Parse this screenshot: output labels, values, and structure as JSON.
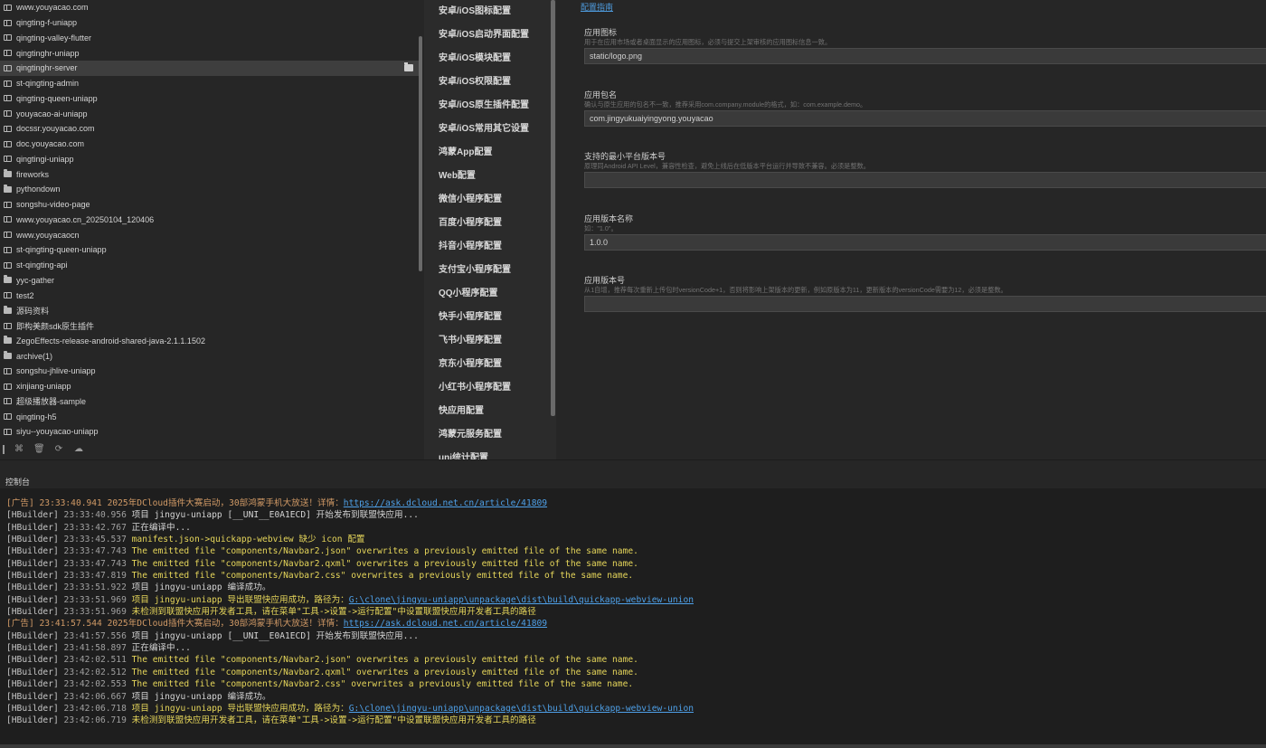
{
  "sidebar": {
    "items": [
      {
        "label": "www.youyacao.com",
        "icon": "project-icon"
      },
      {
        "label": "qingting-f-uniapp",
        "icon": "project-icon"
      },
      {
        "label": "qingting-valley-flutter",
        "icon": "project-icon"
      },
      {
        "label": "qingtinghr-uniapp",
        "icon": "project-icon"
      },
      {
        "label": "qingtinghr-server",
        "icon": "project-icon",
        "selected": true
      },
      {
        "label": "st-qingting-admin",
        "icon": "project-icon"
      },
      {
        "label": "qingting-queen-uniapp",
        "icon": "project-icon"
      },
      {
        "label": "youyacao-ai-uniapp",
        "icon": "project-icon"
      },
      {
        "label": "docssr.youyacao.com",
        "icon": "project-icon"
      },
      {
        "label": "doc.youyacao.com",
        "icon": "project-icon"
      },
      {
        "label": "qingtingi-uniapp",
        "icon": "project-icon"
      },
      {
        "label": "fireworks",
        "icon": "folder-icon"
      },
      {
        "label": "pythondown",
        "icon": "folder-icon"
      },
      {
        "label": "songshu-video-page",
        "icon": "project-icon"
      },
      {
        "label": "www.youyacao.cn_20250104_120406",
        "icon": "project-icon"
      },
      {
        "label": "www.youyacaocn",
        "icon": "project-icon"
      },
      {
        "label": "st-qingting-queen-uniapp",
        "icon": "project-icon"
      },
      {
        "label": "st-qingting-api",
        "icon": "project-icon"
      },
      {
        "label": "yyc-gather",
        "icon": "folder-icon"
      },
      {
        "label": "test2",
        "icon": "project-icon"
      },
      {
        "label": "源码资料",
        "icon": "folder-icon"
      },
      {
        "label": "即构美颜sdk原生插件",
        "icon": "project-icon"
      },
      {
        "label": "ZegoEffects-release-android-shared-java-2.1.1.1502",
        "icon": "folder-icon"
      },
      {
        "label": "archive(1)",
        "icon": "folder-icon"
      },
      {
        "label": "songshu-jhlive-uniapp",
        "icon": "project-icon"
      },
      {
        "label": "xinjiang-uniapp",
        "icon": "project-icon"
      },
      {
        "label": "超级播放器-sample",
        "icon": "project-icon"
      },
      {
        "label": "qingting-h5",
        "icon": "project-icon"
      },
      {
        "label": "siyu--youyacao-uniapp",
        "icon": "project-icon"
      }
    ],
    "toolbar_icons": [
      "divider",
      "graph-icon",
      "trash-icon",
      "refresh-icon",
      "cloud-icon"
    ]
  },
  "config_nav": {
    "items": [
      "安卓/iOS图标配置",
      "安卓/iOS启动界面配置",
      "安卓/iOS模块配置",
      "安卓/iOS权限配置",
      "安卓/iOS原生插件配置",
      "安卓/iOS常用其它设置",
      "鸿蒙App配置",
      "Web配置",
      "微信小程序配置",
      "百度小程序配置",
      "抖音小程序配置",
      "支付宝小程序配置",
      "QQ小程序配置",
      "快手小程序配置",
      "飞书小程序配置",
      "京东小程序配置",
      "小红书小程序配置",
      "快应用配置",
      "鸿蒙元服务配置",
      "uni统计配置"
    ]
  },
  "form": {
    "guide_link": "配置指南",
    "fields": [
      {
        "label": "应用图标",
        "desc": "用于在应用市场或者桌面显示的应用图标，必须与提交上架审核的应用图标信息一致。",
        "value": "static/logo.png"
      },
      {
        "label": "应用包名",
        "desc": "确认与原生应用的包名不一致，推荐采用com.company.module的格式，如：com.example.demo。",
        "value": "com.jingyukuaiyingyong.youyacao"
      },
      {
        "label": "支持的最小平台版本号",
        "desc": "原理同Android API Level，兼容性检查，避免上线后在低版本平台运行并导致不兼容。必须是整数。",
        "value": ""
      },
      {
        "label": "应用版本名称",
        "desc": "如：\"1.0\"。",
        "value": "1.0.0"
      },
      {
        "label": "应用版本号",
        "desc": "从1自增，推荐每次重新上传包时versionCode+1，否则将影响上架版本的更新，例如原版本为11，更新版本的versionCode需要为12，必须是整数。",
        "value": ""
      }
    ]
  },
  "console": {
    "tab_label": "控制台",
    "lines": [
      [
        {
          "t": "[广告] ",
          "c": "ad"
        },
        {
          "t": "23:33:40.941 ",
          "c": "ad"
        },
        {
          "t": "2025年DCloud插件大赛启动，30部鸿蒙手机大放送！详情：",
          "c": "ad"
        },
        {
          "t": "https://ask.dcloud.net.cn/article/41809",
          "c": "link"
        }
      ],
      [
        {
          "t": "[HBuilder] ",
          "c": "tag"
        },
        {
          "t": "23:33:40.956 ",
          "c": "time"
        },
        {
          "t": "项目 jingyu-uniapp [__UNI__E0A1ECD] 开始发布到联盟快应用...",
          "c": "msg"
        }
      ],
      [
        {
          "t": "[HBuilder] ",
          "c": "tag"
        },
        {
          "t": "23:33:42.767 ",
          "c": "time"
        },
        {
          "t": "正在编译中...",
          "c": "msg"
        }
      ],
      [
        {
          "t": "[HBuilder] ",
          "c": "tag"
        },
        {
          "t": "23:33:45.537 ",
          "c": "time"
        },
        {
          "t": "manifest.json->quickapp-webview 缺少 icon 配置",
          "c": "yellow"
        }
      ],
      [
        {
          "t": "[HBuilder] ",
          "c": "tag"
        },
        {
          "t": "23:33:47.743 ",
          "c": "time"
        },
        {
          "t": "The emitted file \"components/Navbar2.json\" overwrites a previously emitted file of the same name.",
          "c": "yellow"
        }
      ],
      [
        {
          "t": "[HBuilder] ",
          "c": "tag"
        },
        {
          "t": "23:33:47.743 ",
          "c": "time"
        },
        {
          "t": "The emitted file \"components/Navbar2.qxml\" overwrites a previously emitted file of the same name.",
          "c": "yellow"
        }
      ],
      [
        {
          "t": "[HBuilder] ",
          "c": "tag"
        },
        {
          "t": "23:33:47.819 ",
          "c": "time"
        },
        {
          "t": "The emitted file \"components/Navbar2.css\" overwrites a previously emitted file of the same name.",
          "c": "yellow"
        }
      ],
      [
        {
          "t": "[HBuilder] ",
          "c": "tag"
        },
        {
          "t": "23:33:51.922 ",
          "c": "time"
        },
        {
          "t": "项目 jingyu-uniapp 编译成功。",
          "c": "msg"
        }
      ],
      [
        {
          "t": "[HBuilder] ",
          "c": "tag"
        },
        {
          "t": "23:33:51.969 ",
          "c": "time"
        },
        {
          "t": "项目 jingyu-uniapp 导出联盟快应用成功，路径为：",
          "c": "yellow"
        },
        {
          "t": "G:\\clone\\jingyu-uniapp\\unpackage\\dist\\build\\quickapp-webview-union",
          "c": "link"
        }
      ],
      [
        {
          "t": "[HBuilder] ",
          "c": "tag"
        },
        {
          "t": "23:33:51.969 ",
          "c": "time"
        },
        {
          "t": "未检测到联盟快应用开发者工具，请在菜单\"工具->设置->运行配置\"中设置联盟快应用开发者工具的路径",
          "c": "yellow"
        }
      ],
      [
        {
          "t": "[广告] ",
          "c": "ad"
        },
        {
          "t": "23:41:57.544 ",
          "c": "ad"
        },
        {
          "t": "2025年DCloud插件大赛启动，30部鸿蒙手机大放送！详情：",
          "c": "ad"
        },
        {
          "t": "https://ask.dcloud.net.cn/article/41809",
          "c": "link"
        }
      ],
      [
        {
          "t": "[HBuilder] ",
          "c": "tag"
        },
        {
          "t": "23:41:57.556 ",
          "c": "time"
        },
        {
          "t": "项目 jingyu-uniapp [__UNI__E0A1ECD] 开始发布到联盟快应用...",
          "c": "msg"
        }
      ],
      [
        {
          "t": "[HBuilder] ",
          "c": "tag"
        },
        {
          "t": "23:41:58.897 ",
          "c": "time"
        },
        {
          "t": "正在编译中...",
          "c": "msg"
        }
      ],
      [
        {
          "t": "[HBuilder] ",
          "c": "tag"
        },
        {
          "t": "23:42:02.511 ",
          "c": "time"
        },
        {
          "t": "The emitted file \"components/Navbar2.json\" overwrites a previously emitted file of the same name.",
          "c": "yellow"
        }
      ],
      [
        {
          "t": "[HBuilder] ",
          "c": "tag"
        },
        {
          "t": "23:42:02.512 ",
          "c": "time"
        },
        {
          "t": "The emitted file \"components/Navbar2.qxml\" overwrites a previously emitted file of the same name.",
          "c": "yellow"
        }
      ],
      [
        {
          "t": "[HBuilder] ",
          "c": "tag"
        },
        {
          "t": "23:42:02.553 ",
          "c": "time"
        },
        {
          "t": "The emitted file \"components/Navbar2.css\" overwrites a previously emitted file of the same name.",
          "c": "yellow"
        }
      ],
      [
        {
          "t": "[HBuilder] ",
          "c": "tag"
        },
        {
          "t": "23:42:06.667 ",
          "c": "time"
        },
        {
          "t": "项目 jingyu-uniapp 编译成功。",
          "c": "msg"
        }
      ],
      [
        {
          "t": "[HBuilder] ",
          "c": "tag"
        },
        {
          "t": "23:42:06.718 ",
          "c": "time"
        },
        {
          "t": "项目 jingyu-uniapp 导出联盟快应用成功，路径为：",
          "c": "yellow"
        },
        {
          "t": "G:\\clone\\jingyu-uniapp\\unpackage\\dist\\build\\quickapp-webview-union",
          "c": "link"
        }
      ],
      [
        {
          "t": "[HBuilder] ",
          "c": "tag"
        },
        {
          "t": "23:42:06.719 ",
          "c": "time"
        },
        {
          "t": "未检测到联盟快应用开发者工具，请在菜单\"工具->设置->运行配置\"中设置联盟快应用开发者工具的路径",
          "c": "yellow"
        }
      ]
    ]
  },
  "colors": {
    "background": "#262626",
    "console_bg": "#1e1e1e",
    "ad": "#d19a66",
    "warning": "#e5d55a",
    "link": "#4ea0e8"
  }
}
